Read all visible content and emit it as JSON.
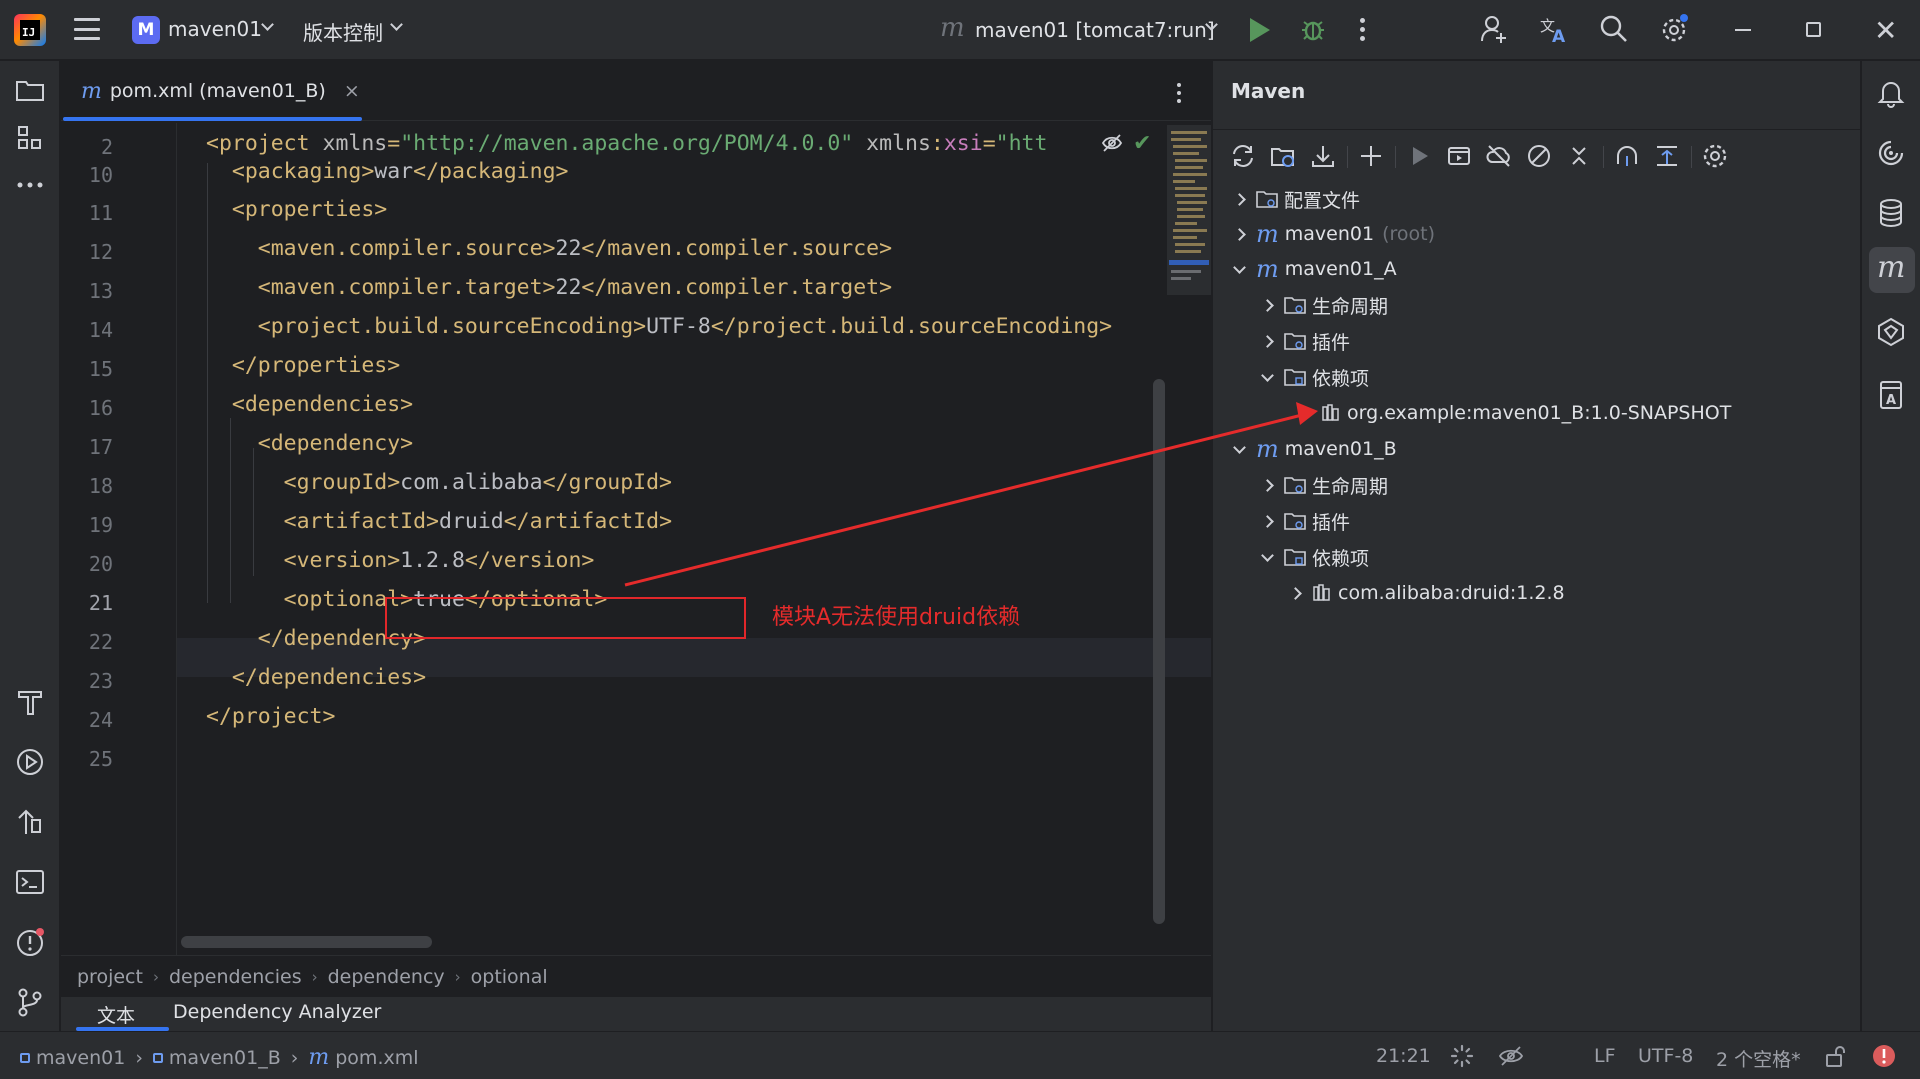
{
  "topbar": {
    "project_name": "maven01",
    "project_badge": "M",
    "vcs_label": "版本控制",
    "run_config": "maven01 [tomcat7:run]"
  },
  "editor": {
    "tab_label": "pom.xml (maven01_B)",
    "tab_close": "×",
    "lines": [
      {
        "num": "2",
        "parts": [
          [
            "tag",
            "<project "
          ],
          [
            "attr",
            "xmlns"
          ],
          [
            "tag",
            "="
          ],
          [
            "str",
            "\"http://maven.apache.org/POM/4.0.0\""
          ],
          [
            "attr",
            " xmlns"
          ],
          [
            "tag",
            ":"
          ],
          [
            "ns",
            "xsi"
          ],
          [
            "tag",
            "="
          ],
          [
            "str",
            "\"htt"
          ]
        ]
      },
      {
        "num": "10",
        "parts": [
          [
            "tag",
            "  <packaging>"
          ],
          [
            "txt",
            "war"
          ],
          [
            "tag",
            "</packaging>"
          ]
        ]
      },
      {
        "num": "11",
        "parts": [
          [
            "tag",
            "  <properties>"
          ]
        ]
      },
      {
        "num": "12",
        "parts": [
          [
            "tag",
            "    <maven.compiler.source>"
          ],
          [
            "txt",
            "22"
          ],
          [
            "tag",
            "</maven.compiler.source>"
          ]
        ]
      },
      {
        "num": "13",
        "parts": [
          [
            "tag",
            "    <maven.compiler.target>"
          ],
          [
            "txt",
            "22"
          ],
          [
            "tag",
            "</maven.compiler.target>"
          ]
        ]
      },
      {
        "num": "14",
        "parts": [
          [
            "tag",
            "    <project.build.sourceEncoding>"
          ],
          [
            "txt",
            "UTF-8"
          ],
          [
            "tag",
            "</project.build.sourceEncoding>"
          ]
        ]
      },
      {
        "num": "15",
        "parts": [
          [
            "tag",
            "  </properties>"
          ]
        ]
      },
      {
        "num": "16",
        "parts": [
          [
            "tag",
            "  <dependencies>"
          ]
        ]
      },
      {
        "num": "17",
        "parts": [
          [
            "tag",
            "    <dependency>"
          ]
        ]
      },
      {
        "num": "18",
        "parts": [
          [
            "tag",
            "      <groupId>"
          ],
          [
            "txt",
            "com.alibaba"
          ],
          [
            "tag",
            "</groupId>"
          ]
        ]
      },
      {
        "num": "19",
        "parts": [
          [
            "tag",
            "      <artifactId>"
          ],
          [
            "txt",
            "druid"
          ],
          [
            "tag",
            "</artifactId>"
          ]
        ]
      },
      {
        "num": "20",
        "parts": [
          [
            "tag",
            "      <version>"
          ],
          [
            "txt",
            "1.2.8"
          ],
          [
            "tag",
            "</version>"
          ]
        ]
      },
      {
        "num": "21",
        "parts": [
          [
            "tag",
            "      <optional>"
          ],
          [
            "txt",
            "true"
          ],
          [
            "tag",
            "</optional>"
          ]
        ]
      },
      {
        "num": "22",
        "parts": [
          [
            "tag",
            "    </dependency>"
          ]
        ]
      },
      {
        "num": "23",
        "parts": [
          [
            "tag",
            "  </dependencies>"
          ]
        ]
      },
      {
        "num": "24",
        "parts": [
          [
            "tag",
            "</project>"
          ]
        ]
      },
      {
        "num": "25",
        "parts": []
      }
    ],
    "current_line": "21",
    "annotation": "模块A无法使用druid依赖",
    "breadcrumb": [
      "project",
      "dependencies",
      "dependency",
      "optional"
    ],
    "bottom_tabs": [
      "文本",
      "Dependency Analyzer"
    ]
  },
  "maven": {
    "title": "Maven",
    "tree": {
      "config_files": "配置文件",
      "root_name": "maven01",
      "root_suffix": "(root)",
      "module_a": "maven01_A",
      "a_lifecycle": "生命周期",
      "a_plugins": "插件",
      "a_deps": "依赖项",
      "a_dep1": "org.example:maven01_B:1.0-SNAPSHOT",
      "module_b": "maven01_B",
      "b_lifecycle": "生命周期",
      "b_plugins": "插件",
      "b_deps": "依赖项",
      "b_dep1": "com.alibaba:druid:1.2.8"
    }
  },
  "statusbar": {
    "path": [
      "maven01",
      "maven01_B",
      "pom.xml"
    ],
    "position": "21:21",
    "line_sep": "LF",
    "encoding": "UTF-8",
    "indent": "2 个空格*"
  },
  "colors": {
    "accent": "#3574f0",
    "annotation_red": "#e52b2b",
    "run_green": "#57965c",
    "maven_blue": "#6e9cf0",
    "xml_tag": "#d5b778",
    "xml_string": "#6aab73"
  }
}
